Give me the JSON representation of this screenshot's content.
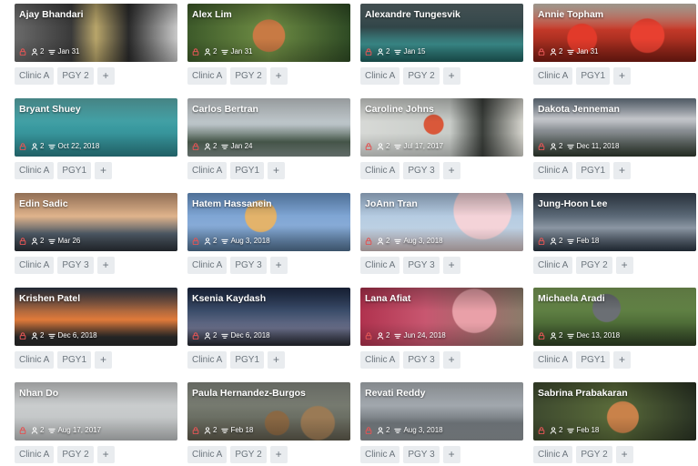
{
  "residents": [
    {
      "name": "Ajay Bhandari",
      "count": "2",
      "date": "Jan 31",
      "tags": [
        "Clinic A",
        "PGY 2"
      ]
    },
    {
      "name": "Alex Lim",
      "count": "2",
      "date": "Jan 31",
      "tags": [
        "Clinic A",
        "PGY 2"
      ]
    },
    {
      "name": "Alexandre Tungesvik",
      "count": "2",
      "date": "Jan 15",
      "tags": [
        "Clinic A",
        "PGY 2"
      ]
    },
    {
      "name": "Annie Topham",
      "count": "2",
      "date": "Jan 31",
      "tags": [
        "Clinic A",
        "PGY1"
      ]
    },
    {
      "name": "Bryant Shuey",
      "count": "2",
      "date": "Oct 22, 2018",
      "tags": [
        "Clinic A",
        "PGY1"
      ]
    },
    {
      "name": "Carlos Bertran",
      "count": "2",
      "date": "Jan 24",
      "tags": [
        "Clinic A",
        "PGY1"
      ]
    },
    {
      "name": "Caroline Johns",
      "count": "2",
      "date": "Jul 17, 2017",
      "tags": [
        "Clinic A",
        "PGY 3"
      ]
    },
    {
      "name": "Dakota Jenneman",
      "count": "2",
      "date": "Dec 11, 2018",
      "tags": [
        "Clinic A",
        "PGY1"
      ]
    },
    {
      "name": "Edin Sadic",
      "count": "2",
      "date": "Mar 26",
      "tags": [
        "Clinic A",
        "PGY 3"
      ]
    },
    {
      "name": "Hatem Hassanein",
      "count": "2",
      "date": "Aug 3, 2018",
      "tags": [
        "Clinic A",
        "PGY 3"
      ]
    },
    {
      "name": "JoAnn Tran",
      "count": "2",
      "date": "Aug 3, 2018",
      "tags": [
        "Clinic A",
        "PGY 3"
      ]
    },
    {
      "name": "Jung-Hoon Lee",
      "count": "2",
      "date": "Feb 18",
      "tags": [
        "Clinic A",
        "PGY 2"
      ]
    },
    {
      "name": "Krishen Patel",
      "count": "2",
      "date": "Dec 6, 2018",
      "tags": [
        "Clinic A",
        "PGY1"
      ]
    },
    {
      "name": "Ksenia Kaydash",
      "count": "2",
      "date": "Dec 6, 2018",
      "tags": [
        "Clinic A",
        "PGY1"
      ]
    },
    {
      "name": "Lana Afiat",
      "count": "2",
      "date": "Jun 24, 2018",
      "tags": [
        "Clinic A",
        "PGY 3"
      ]
    },
    {
      "name": "Michaela Aradi",
      "count": "2",
      "date": "Dec 13, 2018",
      "tags": [
        "Clinic A",
        "PGY1"
      ]
    },
    {
      "name": "Nhan Do",
      "count": "2",
      "date": "Aug 17, 2017",
      "tags": [
        "Clinic A",
        "PGY 2"
      ]
    },
    {
      "name": "Paula Hernandez-Burgos",
      "count": "2",
      "date": "Feb 18",
      "tags": [
        "Clinic A",
        "PGY 2"
      ]
    },
    {
      "name": "Revati Reddy",
      "count": "2",
      "date": "Aug 3, 2018",
      "tags": [
        "Clinic A",
        "PGY 3"
      ]
    },
    {
      "name": "Sabrina Prabakaran",
      "count": "2",
      "date": "Feb 18",
      "tags": [
        "Clinic A",
        "PGY 2"
      ]
    }
  ],
  "add_label": "+",
  "colors": {
    "tag_bg": "#e9ecef",
    "tag_text": "#6c757d",
    "lock_icon": "#e05555"
  }
}
